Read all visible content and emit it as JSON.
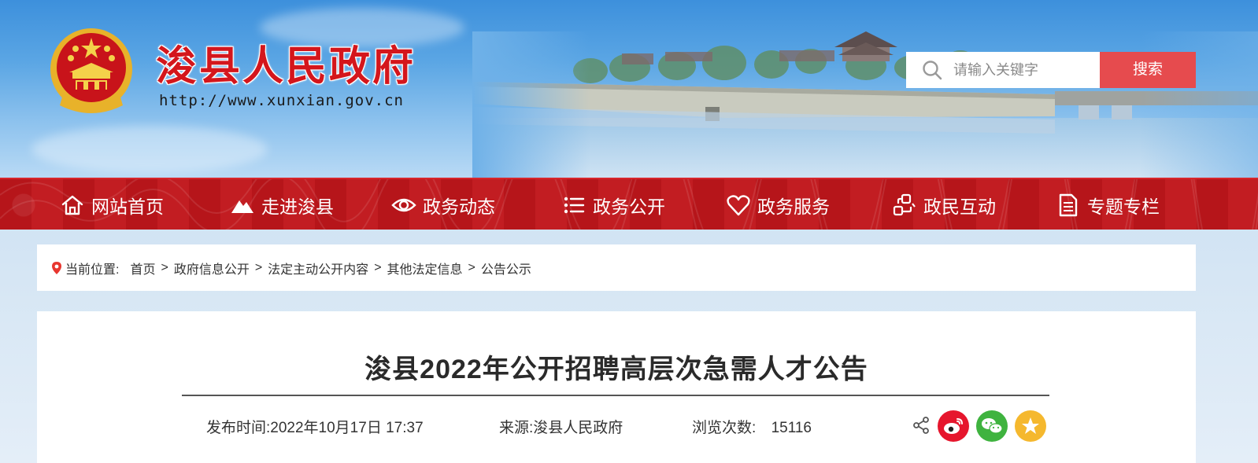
{
  "header": {
    "site_title": "浚县人民政府",
    "site_url": "http://www.xunxian.gov.cn",
    "emblem_icon": "national-emblem-icon",
    "search": {
      "placeholder": "请输入关键字",
      "value": "",
      "button_label": "搜索",
      "icon": "search-icon"
    }
  },
  "nav": {
    "items": [
      {
        "label": "网站首页",
        "icon": "home-icon"
      },
      {
        "label": "走进浚县",
        "icon": "mountain-icon"
      },
      {
        "label": "政务动态",
        "icon": "eye-icon"
      },
      {
        "label": "政务公开",
        "icon": "list-icon"
      },
      {
        "label": "政务服务",
        "icon": "heart-icon"
      },
      {
        "label": "政民互动",
        "icon": "interaction-icon"
      },
      {
        "label": "专题专栏",
        "icon": "document-icon"
      }
    ]
  },
  "breadcrumb": {
    "lead": "当前位置:",
    "separator": ">",
    "items": [
      "首页",
      "政府信息公开",
      "法定主动公开内容",
      "其他法定信息",
      "公告公示"
    ]
  },
  "article": {
    "title": "浚县2022年公开招聘高层次急需人才公告",
    "published": "发布时间:2022年10月17日 17:37",
    "source": "来源:浚县人民政府",
    "views_label": "浏览次数:",
    "views_count": "15116",
    "share": [
      "share-icon",
      "weibo-icon",
      "wechat-icon",
      "favorite-icon"
    ]
  },
  "colors": {
    "brand_red": "#c0161b",
    "title_red": "#d4161c",
    "search_button": "#e64b4e",
    "weibo": "#e6162d",
    "wechat": "#3fb33f",
    "favorite": "#f5b82e"
  }
}
